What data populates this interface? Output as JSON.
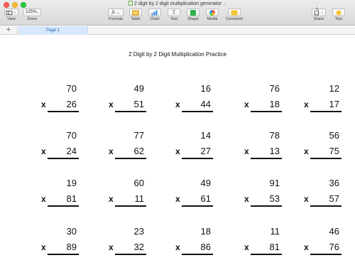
{
  "window": {
    "title": "2 digit by 2 digit multiplication generator"
  },
  "toolbar": {
    "view_label": "View",
    "zoom_value": "125%",
    "zoom_label": "Zoom",
    "formula_label": "Formula",
    "formula_icon": "fx",
    "table_label": "Table",
    "chart_label": "Chart",
    "text_label": "Text",
    "shape_label": "Shape",
    "media_label": "Media",
    "comment_label": "Comment",
    "share_label": "Share",
    "tips_label": "Tips"
  },
  "tabs": {
    "add_label": "+",
    "pages": [
      "Page 1"
    ]
  },
  "document": {
    "title": "2 Digit by 2 Digit Multiplication Practice",
    "operator": "x",
    "rows": [
      [
        {
          "top": "70",
          "bottom": "26"
        },
        {
          "top": "49",
          "bottom": "51"
        },
        {
          "top": "16",
          "bottom": "44"
        },
        {
          "top": "76",
          "bottom": "18"
        },
        {
          "top": "12",
          "bottom": "17"
        }
      ],
      [
        {
          "top": "70",
          "bottom": "24"
        },
        {
          "top": "77",
          "bottom": "62"
        },
        {
          "top": "14",
          "bottom": "27"
        },
        {
          "top": "78",
          "bottom": "13"
        },
        {
          "top": "56",
          "bottom": "75"
        }
      ],
      [
        {
          "top": "19",
          "bottom": "81"
        },
        {
          "top": "60",
          "bottom": "11"
        },
        {
          "top": "49",
          "bottom": "61"
        },
        {
          "top": "91",
          "bottom": "53"
        },
        {
          "top": "36",
          "bottom": "57"
        }
      ],
      [
        {
          "top": "30",
          "bottom": "89"
        },
        {
          "top": "23",
          "bottom": "32"
        },
        {
          "top": "18",
          "bottom": "86"
        },
        {
          "top": "11",
          "bottom": "81"
        },
        {
          "top": "46",
          "bottom": "76"
        }
      ]
    ]
  }
}
